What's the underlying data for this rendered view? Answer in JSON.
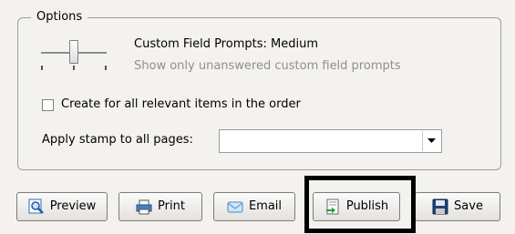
{
  "options": {
    "legend": "Options",
    "prompt_title": "Custom Field Prompts: Medium",
    "prompt_description": "Show only unanswered custom field prompts",
    "slider_level": "Medium",
    "checkbox_label": "Create for all relevant items in the order",
    "checkbox_checked": false,
    "stamp_label": "Apply stamp to all pages:",
    "stamp_value": ""
  },
  "buttons": {
    "preview": "Preview",
    "print": "Print",
    "email": "Email",
    "publish": "Publish",
    "save": "Save"
  },
  "colors": {
    "background": "#f4f2ee",
    "highlight": "#000000",
    "muted_text": "#8f8f8f"
  }
}
